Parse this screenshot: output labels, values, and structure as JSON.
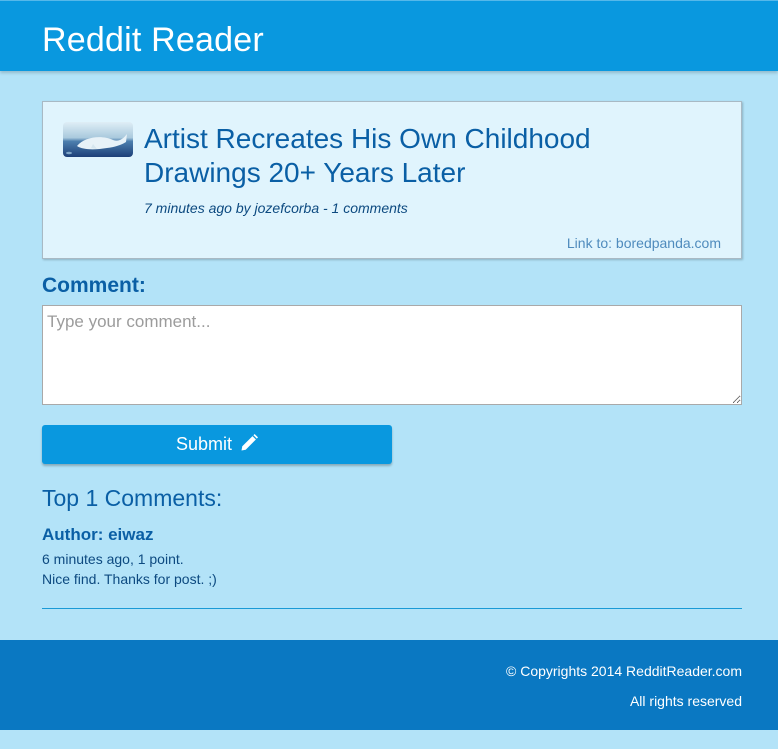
{
  "header": {
    "title": "Reddit Reader"
  },
  "post": {
    "thumbnail_icon": "whale-thumbnail",
    "title": "Artist Recreates His Own Childhood Drawings 20+ Years Later",
    "meta": "7 minutes ago by jozefcorba - 1 comments",
    "link_prefix": "Link to: ",
    "link_domain": "boredpanda.com"
  },
  "comment_form": {
    "label": "Comment:",
    "placeholder": "Type your comment...",
    "value": "",
    "submit_label": "Submit",
    "submit_icon": "pencil-icon"
  },
  "comments": {
    "heading": "Top 1 Comments:",
    "items": [
      {
        "author": "Author: eiwaz",
        "meta": "6 minutes ago, 1 point.",
        "body": "Nice find. Thanks for post. ;)"
      }
    ]
  },
  "footer": {
    "copyright": "© Copyrights 2014 RedditReader.com",
    "rights": "All rights reserved"
  },
  "colors": {
    "page_background": "#b3e3f8",
    "header_background": "#0998df",
    "footer_background": "#0a78c2",
    "card_background": "#e0f4fd",
    "heading_text": "#0a5fa5",
    "submit_button": "#0998df"
  }
}
